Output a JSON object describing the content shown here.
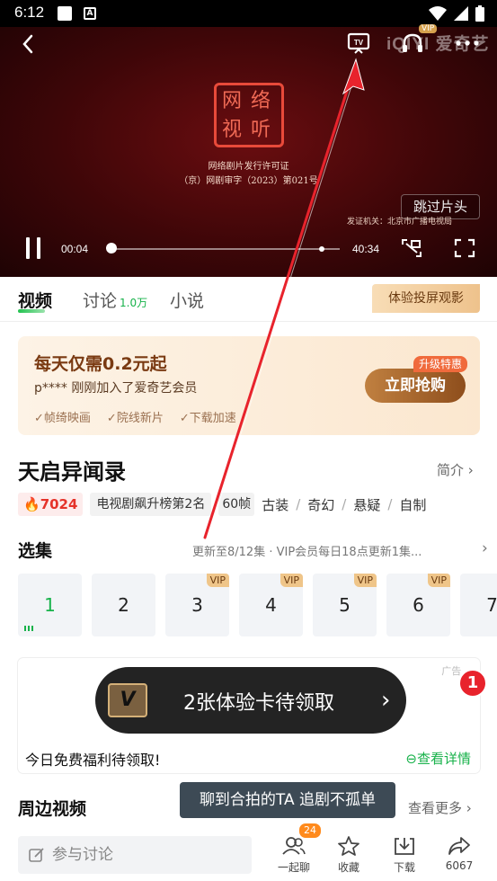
{
  "status_bar": {
    "time": "6:12",
    "notification_icon": "A"
  },
  "player": {
    "logo_text": "iQIYI 爱奇艺",
    "vip_tag": "VIP",
    "seal_text": [
      "网",
      "络",
      "视",
      "听"
    ],
    "license_line1": "网络剧片发行许可证",
    "license_line2": "（京）网剧审字（2023）第021号",
    "issuer": "发证机关：北京市广播电视局",
    "skip_label": "跳过片头",
    "current_time": "00:04",
    "total_time": "40:34",
    "progress_fraction": 0.002
  },
  "tabs": [
    {
      "label": "视频",
      "count": ""
    },
    {
      "label": "讨论",
      "count": "1.0万"
    },
    {
      "label": "小说",
      "count": ""
    }
  ],
  "cast_promo": "体验投屏观影",
  "vip_card": {
    "title": "每天仅需0.2元起",
    "subtitle": "p**** 刚刚加入了爱奇艺会员",
    "benefits": [
      "帧绮映画",
      "院线新片",
      "下载加速"
    ],
    "badge": "升级特惠",
    "button": "立即抢购"
  },
  "show": {
    "title": "天启异闻录",
    "intro_label": "简介",
    "heat": "7024",
    "rank": "电视剧飙升榜第2名",
    "fps": "60帧",
    "genres": [
      "古装",
      "奇幻",
      "悬疑",
      "自制"
    ]
  },
  "episodes": {
    "title": "选集",
    "update_text": "更新至8/12集 · VIP会员每日18点更新1集...",
    "vip_label": "VIP",
    "list": [
      {
        "num": "1",
        "vip": false,
        "current": true
      },
      {
        "num": "2",
        "vip": false,
        "current": false
      },
      {
        "num": "3",
        "vip": true,
        "current": false
      },
      {
        "num": "4",
        "vip": true,
        "current": false
      },
      {
        "num": "5",
        "vip": true,
        "current": false
      },
      {
        "num": "6",
        "vip": true,
        "current": false
      },
      {
        "num": "7",
        "vip": true,
        "current": false
      }
    ]
  },
  "ad": {
    "label": "广告",
    "card_letter": "V",
    "banner_text": "2张体验卡待领取",
    "badge": "1",
    "desc": "今日免费福利待领取!",
    "detail": "查看详情"
  },
  "nearby": {
    "title": "周边视频",
    "more": "查看更多"
  },
  "tooltip": "聊到合拍的TA 追剧不孤单",
  "bottom": {
    "comment_placeholder": "参与讨论",
    "chat_label": "一起聊",
    "chat_badge": "24",
    "fav_label": "收藏",
    "download_label": "下载",
    "share_label": "6067"
  },
  "colors": {
    "accent_green": "#17b24a",
    "annotation_arrow": "#e8232c"
  }
}
